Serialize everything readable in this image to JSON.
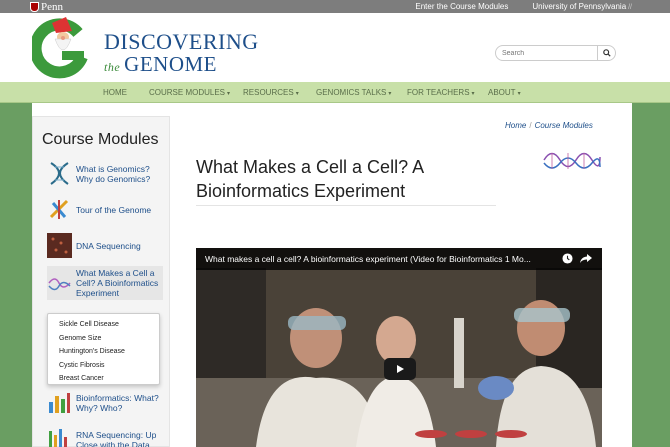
{
  "topbar": {
    "penn_label": "Penn",
    "links": [
      {
        "label": "Enter the Course Modules"
      },
      {
        "label": "University of Pennsylvania"
      }
    ]
  },
  "header": {
    "brand_line1": "DISCOVERING",
    "brand_the": "the",
    "brand_line2": "GENOME",
    "search_placeholder": "Search"
  },
  "nav": {
    "items": [
      {
        "label": "HOME"
      },
      {
        "label": "COURSE MODULES"
      },
      {
        "label": "RESOURCES"
      },
      {
        "label": "GENOMICS TALKS"
      },
      {
        "label": "FOR TEACHERS"
      },
      {
        "label": "ABOUT"
      }
    ]
  },
  "sidebar": {
    "title": "Course Modules",
    "modules": [
      {
        "label": "What is Genomics? Why do Genomics?"
      },
      {
        "label": "Tour of the Genome"
      },
      {
        "label": "DNA Sequencing"
      },
      {
        "label": "What Makes a Cell a Cell? A Bioinformatics Experiment"
      },
      {
        "label": "Bioinformatics: What? Why? Who?"
      },
      {
        "label": "RNA Sequencing: Up Close with the Data"
      }
    ],
    "dropdown": [
      {
        "label": "Sickle Cell Disease"
      },
      {
        "label": "Genome Size"
      },
      {
        "label": "Huntington's Disease"
      },
      {
        "label": "Cystic Fibrosis"
      },
      {
        "label": "Breast Cancer"
      }
    ]
  },
  "breadcrumb": {
    "home": "Home",
    "sep": "/",
    "current": "Course Modules"
  },
  "page": {
    "title": "What Makes a Cell a Cell? A Bioinformatics Experiment"
  },
  "video": {
    "title": "What makes a cell a cell? A bioinformatics experiment (Video for Bioinformatics 1 Mo..."
  },
  "colors": {
    "brand_blue": "#1e4f8a",
    "nav_green": "#c8e0a8",
    "page_green": "#6a9e62"
  }
}
